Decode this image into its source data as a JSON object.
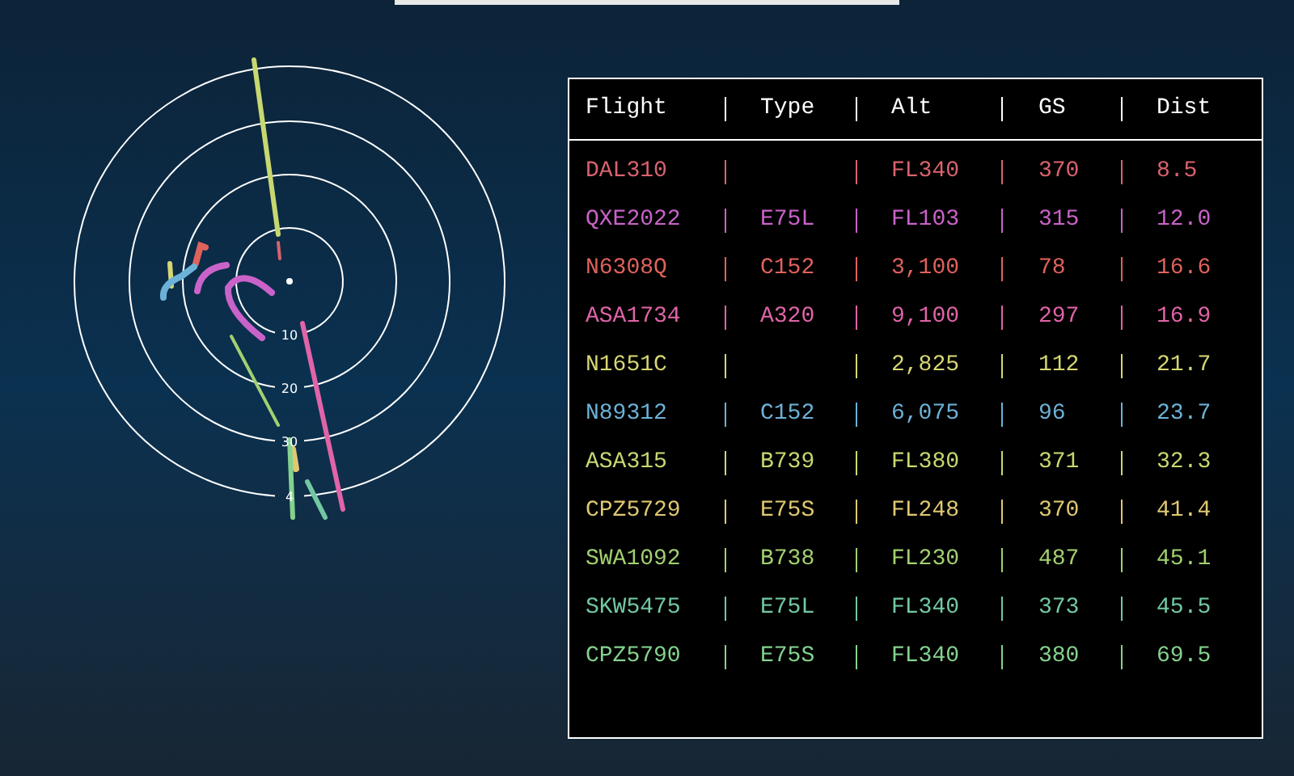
{
  "radar": {
    "range_labels": [
      "10",
      "20",
      "30",
      "4"
    ]
  },
  "table": {
    "columns": [
      "Flight",
      "Type",
      "Alt",
      "GS",
      "Dist"
    ],
    "rows": [
      {
        "flight": "DAL310",
        "alt": "FL340",
        "gs": "370",
        "dist": "8.5",
        "color": "#d9636e"
      },
      {
        "flight": "QXE2022",
        "type": "E75L",
        "alt": "FL103",
        "gs": "315",
        "dist": "12.0",
        "color": "#c963c9"
      },
      {
        "flight": "N6308Q",
        "type": "C152",
        "alt": "3,100",
        "gs": "78",
        "dist": "16.6",
        "color": "#e0625c"
      },
      {
        "flight": "ASA1734",
        "type": "A320",
        "alt": "9,100",
        "gs": "297",
        "dist": "16.9",
        "color": "#e064a8"
      },
      {
        "flight": "N1651C",
        "alt": "2,825",
        "gs": "112",
        "dist": "21.7",
        "color": "#d6d673"
      },
      {
        "flight": "N89312",
        "type": "C152",
        "alt": "6,075",
        "gs": "96",
        "dist": "23.7",
        "color": "#6cb2d8"
      },
      {
        "flight": "ASA315",
        "type": "B739",
        "alt": "FL380",
        "gs": "371",
        "dist": "32.3",
        "color": "#c8d870"
      },
      {
        "flight": "CPZ5729",
        "type": "E75S",
        "alt": "FL248",
        "gs": "370",
        "dist": "41.4",
        "color": "#e0c872"
      },
      {
        "flight": "SWA1092",
        "type": "B738",
        "alt": "FL230",
        "gs": "487",
        "dist": "45.1",
        "color": "#a2d070"
      },
      {
        "flight": "SKW5475",
        "type": "E75L",
        "alt": "FL340",
        "gs": "373",
        "dist": "45.5",
        "color": "#72c8a2"
      },
      {
        "flight": "CPZ5790",
        "type": "E75S",
        "alt": "FL340",
        "gs": "380",
        "dist": "69.5",
        "color": "#84d28e"
      }
    ]
  }
}
